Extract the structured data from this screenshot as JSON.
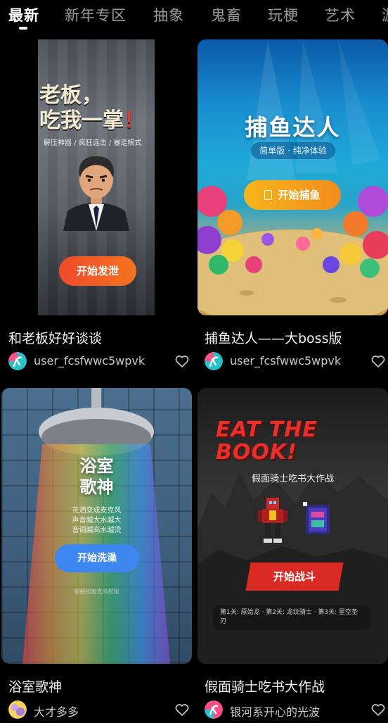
{
  "tabs": [
    {
      "label": "最新",
      "active": true
    },
    {
      "label": "新年专区"
    },
    {
      "label": "抽象"
    },
    {
      "label": "鬼畜"
    },
    {
      "label": "玩梗"
    },
    {
      "label": "艺术"
    },
    {
      "label": "游"
    }
  ],
  "cards": [
    {
      "title": "和老板好好谈谈",
      "author": "user_fcsfwwc5wpvk",
      "thumb": {
        "headline_1": "老板，",
        "headline_2": "吃我一掌",
        "headline_bang": "！",
        "subline": "解压神器 / 疯狂连击 / 暴走模式",
        "button": "开始发泄"
      }
    },
    {
      "title": "捕鱼达人——大boss版",
      "author": "user_fcsfwwc5wpvk",
      "thumb": {
        "headline": "捕鱼达人",
        "subline": "简单版 · 纯净体验",
        "button": "开始捕鱼"
      }
    },
    {
      "title": "浴室歌神",
      "author": "大才多多",
      "thumb": {
        "headline_1": "浴室",
        "headline_2": "歌神",
        "line_1": "花洒变成麦克风",
        "line_2": "声音越大水越大",
        "line_3": "音调越高水越烫",
        "button": "开始洗澡",
        "footer": "需授权麦克风权限"
      }
    },
    {
      "title": "假面骑士吃书大作战",
      "author": "银河系开心的光波",
      "thumb": {
        "headline_1": "EAT THE",
        "headline_2": "BOOK!",
        "subline": "假面骑士吃书大作战",
        "button": "开始战斗",
        "info": "第1关: 原始龙 · 第2关: 龙纹骑士 · 第3关: 星空圣刃"
      }
    }
  ],
  "colors": {
    "background": "#000000",
    "tab_inactive": "#9a9a9a",
    "button_orange": "#f5741f",
    "button_yellow": "#f6b61c",
    "button_blue": "#3e86f0",
    "button_red": "#d92a24"
  }
}
